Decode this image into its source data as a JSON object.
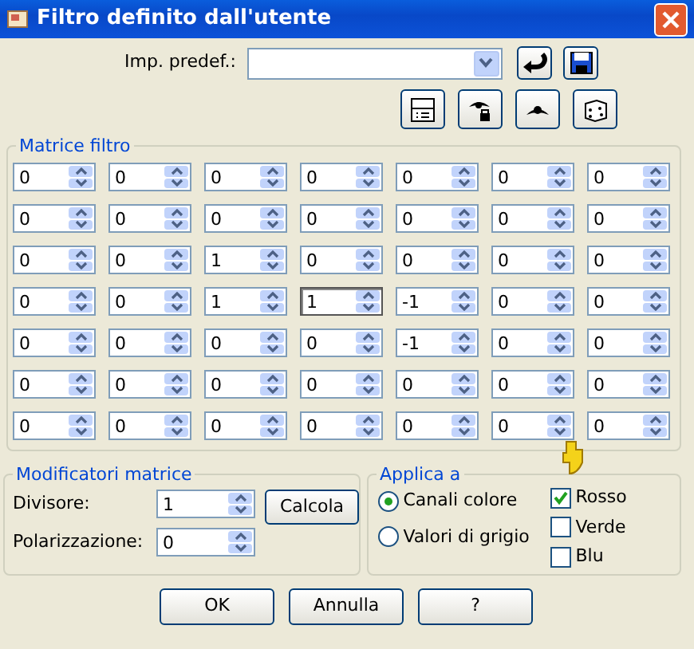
{
  "window": {
    "title": "Filtro definito dall'utente"
  },
  "preset": {
    "label": "Imp. predef.:"
  },
  "matrix": {
    "title": "Matrice filtro",
    "rows": [
      [
        {
          "value": "0",
          "focused": false
        },
        {
          "value": "0",
          "focused": false
        },
        {
          "value": "0",
          "focused": false
        },
        {
          "value": "0",
          "focused": false
        },
        {
          "value": "0",
          "focused": false
        },
        {
          "value": "0",
          "focused": false
        },
        {
          "value": "0",
          "focused": false
        }
      ],
      [
        {
          "value": "0",
          "focused": false
        },
        {
          "value": "0",
          "focused": false
        },
        {
          "value": "0",
          "focused": false
        },
        {
          "value": "0",
          "focused": false
        },
        {
          "value": "0",
          "focused": false
        },
        {
          "value": "0",
          "focused": false
        },
        {
          "value": "0",
          "focused": false
        }
      ],
      [
        {
          "value": "0",
          "focused": false
        },
        {
          "value": "0",
          "focused": false
        },
        {
          "value": "1",
          "focused": false
        },
        {
          "value": "0",
          "focused": false
        },
        {
          "value": "0",
          "focused": false
        },
        {
          "value": "0",
          "focused": false
        },
        {
          "value": "0",
          "focused": false
        }
      ],
      [
        {
          "value": "0",
          "focused": false
        },
        {
          "value": "0",
          "focused": false
        },
        {
          "value": "1",
          "focused": false
        },
        {
          "value": "1",
          "focused": true
        },
        {
          "value": "-1",
          "focused": false
        },
        {
          "value": "0",
          "focused": false
        },
        {
          "value": "0",
          "focused": false
        }
      ],
      [
        {
          "value": "0",
          "focused": false
        },
        {
          "value": "0",
          "focused": false
        },
        {
          "value": "0",
          "focused": false
        },
        {
          "value": "0",
          "focused": false
        },
        {
          "value": "-1",
          "focused": false
        },
        {
          "value": "0",
          "focused": false
        },
        {
          "value": "0",
          "focused": false
        }
      ],
      [
        {
          "value": "0",
          "focused": false
        },
        {
          "value": "0",
          "focused": false
        },
        {
          "value": "0",
          "focused": false
        },
        {
          "value": "0",
          "focused": false
        },
        {
          "value": "0",
          "focused": false
        },
        {
          "value": "0",
          "focused": false
        },
        {
          "value": "0",
          "focused": false
        }
      ],
      [
        {
          "value": "0",
          "focused": false
        },
        {
          "value": "0",
          "focused": false
        },
        {
          "value": "0",
          "focused": false
        },
        {
          "value": "0",
          "focused": false
        },
        {
          "value": "0",
          "focused": false
        },
        {
          "value": "0",
          "focused": false
        },
        {
          "value": "0",
          "focused": false
        }
      ]
    ]
  },
  "modifiers": {
    "title": "Modificatori matrice",
    "fields": [
      {
        "label": "Divisore:",
        "value": "1"
      },
      {
        "label": "Polarizzazione:",
        "value": "0"
      }
    ],
    "button": "Calcola"
  },
  "apply": {
    "title": "Applica a",
    "radios": [
      {
        "label": "Canali colore",
        "selected": true
      },
      {
        "label": "Valori di grigio",
        "selected": false
      }
    ],
    "checks": [
      {
        "label": "Rosso",
        "checked": true
      },
      {
        "label": "Verde",
        "checked": false
      },
      {
        "label": "Blu",
        "checked": false
      }
    ]
  },
  "buttons": [
    "OK",
    "Annulla",
    "?"
  ]
}
